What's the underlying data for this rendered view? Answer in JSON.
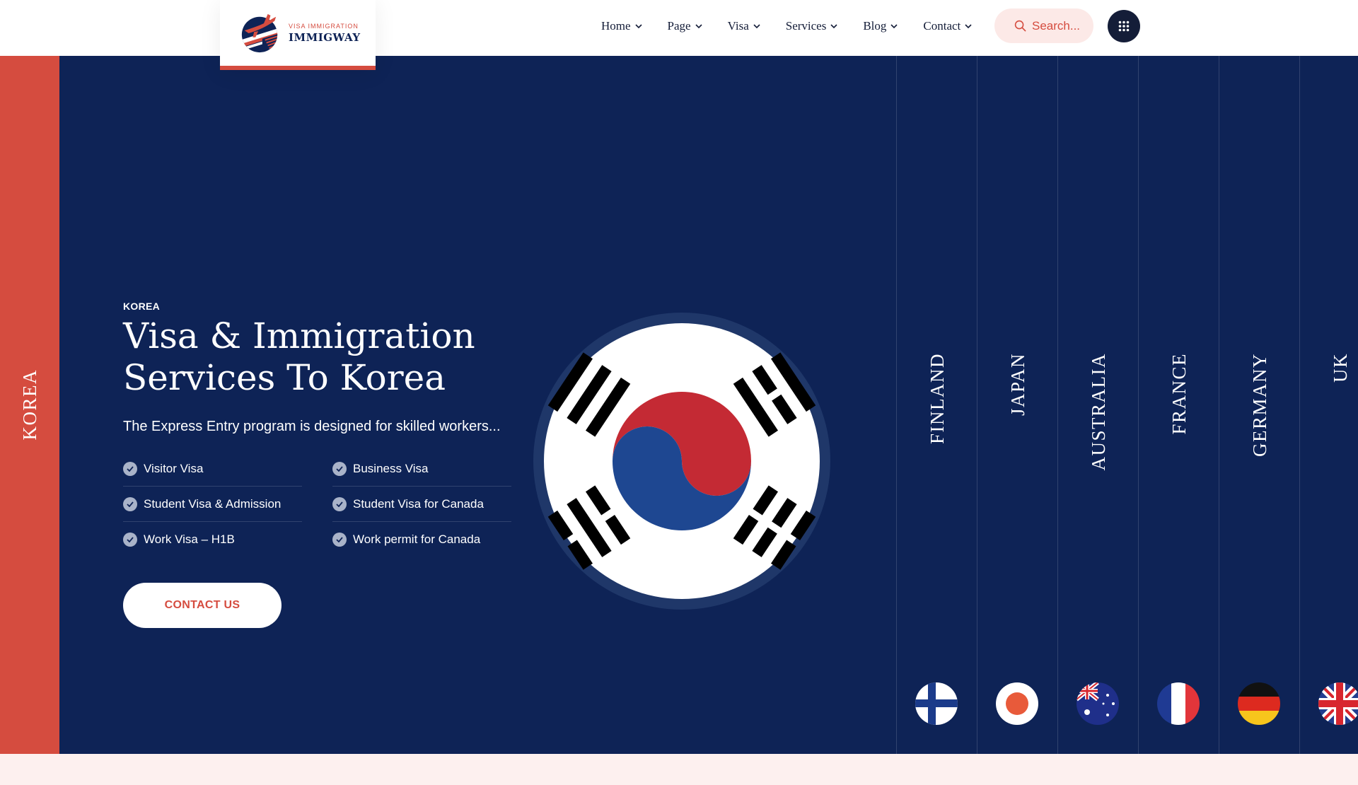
{
  "brand": {
    "tagline": "VISA IMMIGRATION",
    "name": "IMMIGWAY"
  },
  "nav": [
    {
      "label": "Home"
    },
    {
      "label": "Page"
    },
    {
      "label": "Visa"
    },
    {
      "label": "Services"
    },
    {
      "label": "Blog"
    },
    {
      "label": "Contact"
    }
  ],
  "search": {
    "placeholder": "Search..."
  },
  "hero": {
    "active_tab": "KOREA",
    "subtitle": "KOREA",
    "title_line1": "Visa & Immigration",
    "title_line2": "Services To Korea",
    "description": "The Express Entry program is designed for skilled workers...",
    "features": [
      "Visitor Visa",
      "Business Visa",
      "Student Visa & Admission",
      "Student Visa for Canada",
      "Work Visa – H1B",
      "Work permit for Canada"
    ],
    "cta_label": "CONTACT US"
  },
  "countries": [
    {
      "label": "FINLAND",
      "flag_icon": "finland-flag-icon"
    },
    {
      "label": "JAPAN",
      "flag_icon": "japan-flag-icon"
    },
    {
      "label": "AUSTRALIA",
      "flag_icon": "australia-flag-icon"
    },
    {
      "label": "FRANCE",
      "flag_icon": "france-flag-icon"
    },
    {
      "label": "GERMANY",
      "flag_icon": "germany-flag-icon"
    },
    {
      "label": "UK",
      "flag_icon": "uk-flag-icon"
    }
  ],
  "colors": {
    "navy": "#0e2356",
    "accent_red": "#d54c3f",
    "dark": "#141d38",
    "pale_pink": "#fdf0ef"
  }
}
